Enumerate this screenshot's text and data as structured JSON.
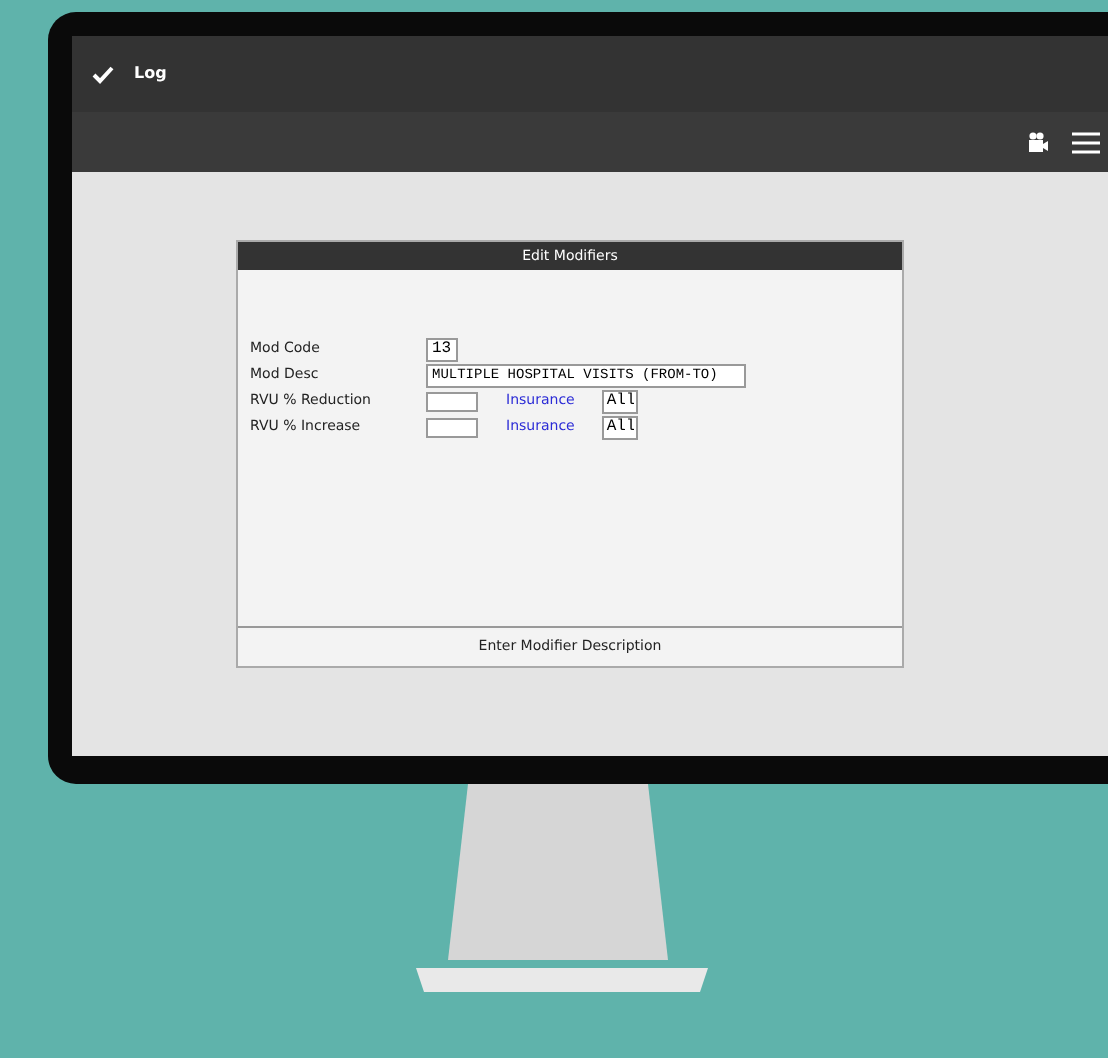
{
  "header": {
    "title": "Log"
  },
  "dialog": {
    "title": "Edit Modifiers",
    "fields": [
      {
        "kind": "short",
        "label": "Mod Code",
        "value": "13"
      },
      {
        "kind": "long",
        "label": "Mod Desc",
        "value": "MULTIPLE HOSPITAL VISITS (FROM-TO)"
      },
      {
        "kind": "rvu",
        "label": "RVU % Reduction",
        "link": "Insurance",
        "option": "All"
      },
      {
        "kind": "rvu",
        "label": "RVU % Increase",
        "link": "Insurance",
        "option": "All"
      }
    ],
    "status": "Enter Modifier Description"
  }
}
